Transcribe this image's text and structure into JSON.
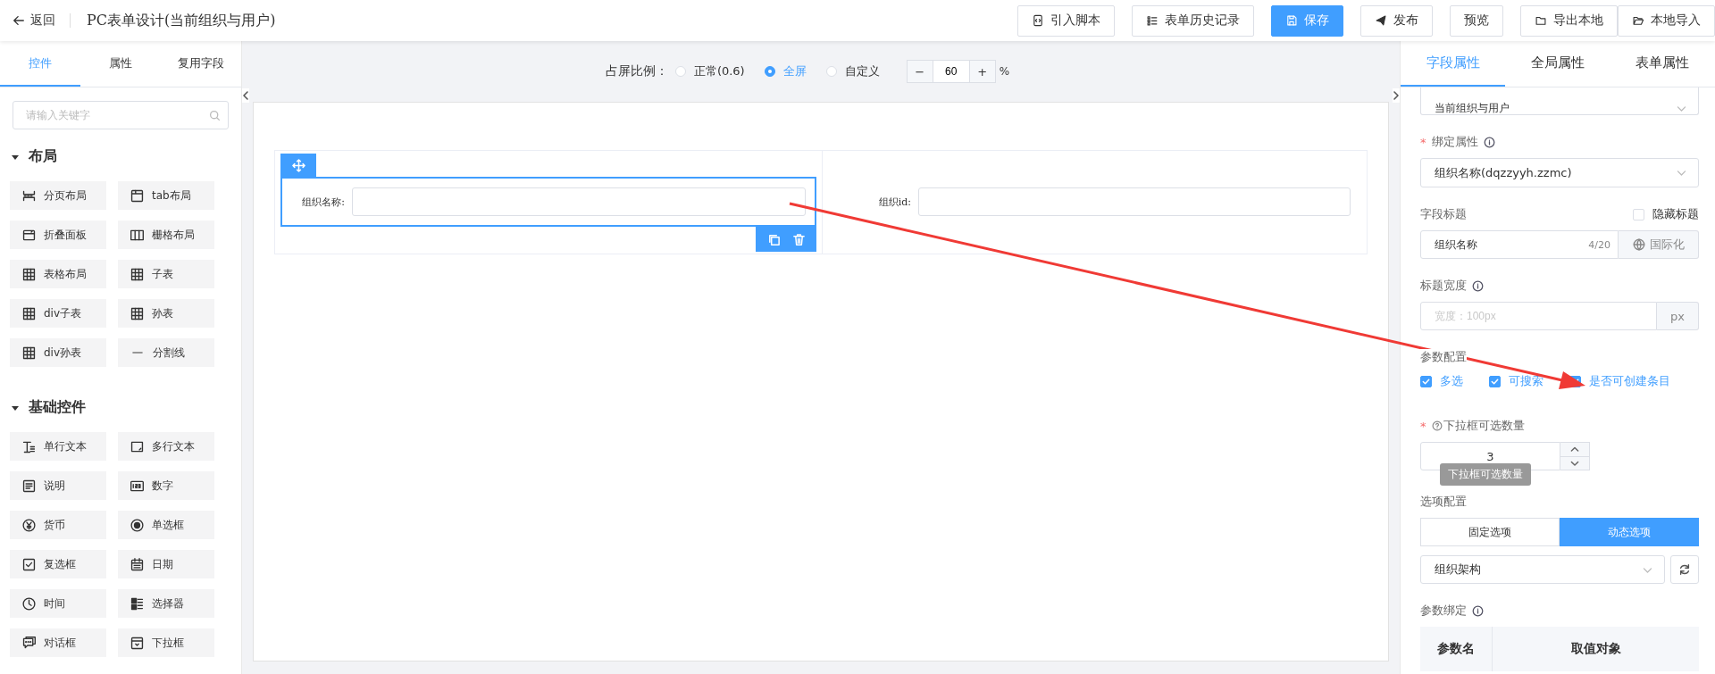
{
  "header": {
    "back": "返回",
    "title": "PC表单设计(当前组织与用户)",
    "buttons": [
      {
        "label": "引入脚本",
        "kind": "script",
        "primary": false
      },
      {
        "label": "表单历史记录",
        "kind": "list",
        "primary": false
      },
      {
        "label": "保存",
        "kind": "save",
        "primary": true
      },
      {
        "label": "发布",
        "kind": "send",
        "primary": false
      },
      {
        "label": "预览",
        "kind": "plain",
        "primary": false
      },
      {
        "label": "导出本地",
        "kind": "folder",
        "primary": false
      },
      {
        "label": "本地导入",
        "kind": "folder-open",
        "primary": false
      }
    ]
  },
  "left_panel": {
    "tabs": [
      {
        "label": "控件",
        "selected": true
      },
      {
        "label": "属性",
        "selected": false
      },
      {
        "label": "复用字段",
        "selected": false
      }
    ],
    "search": {
      "placeholder": "请输入关键字"
    },
    "groups": [
      {
        "title": "布局",
        "expanded": true,
        "items": [
          {
            "label": "分页布局",
            "kind": "pager"
          },
          {
            "label": "tab布局",
            "kind": "tab"
          },
          {
            "label": "折叠面板",
            "kind": "collapse"
          },
          {
            "label": "栅格布局",
            "kind": "columns"
          },
          {
            "label": "表格布局",
            "kind": "table"
          },
          {
            "label": "子表",
            "kind": "table"
          },
          {
            "label": "div子表",
            "kind": "table"
          },
          {
            "label": "孙表",
            "kind": "table"
          },
          {
            "label": "div孙表",
            "kind": "table"
          },
          {
            "label": "分割线",
            "kind": "line"
          }
        ]
      },
      {
        "title": "基础控件",
        "expanded": true,
        "items": [
          {
            "label": "单行文本",
            "kind": "text"
          },
          {
            "label": "多行文本",
            "kind": "textarea"
          },
          {
            "label": "说明",
            "kind": "note"
          },
          {
            "label": "数字",
            "kind": "number"
          },
          {
            "label": "货币",
            "kind": "currency"
          },
          {
            "label": "单选框",
            "kind": "radio"
          },
          {
            "label": "复选框",
            "kind": "checkbox"
          },
          {
            "label": "日期",
            "kind": "date"
          },
          {
            "label": "时间",
            "kind": "time"
          },
          {
            "label": "选择器",
            "kind": "selector"
          },
          {
            "label": "对话框",
            "kind": "dialog"
          },
          {
            "label": "下拉框",
            "kind": "dropdown"
          }
        ]
      }
    ]
  },
  "canvas": {
    "ratio_label": "占屏比例：",
    "ratio_options": [
      {
        "label": "正常(0.6)",
        "selected": false
      },
      {
        "label": "全屏",
        "selected": true
      },
      {
        "label": "自定义",
        "selected": false
      }
    ],
    "zoom": {
      "minus": "−",
      "value": "60",
      "plus": "+",
      "unit": "%"
    },
    "fields": [
      {
        "label": "组织名称:",
        "selected": true
      },
      {
        "label": "组织id:",
        "selected": false
      }
    ]
  },
  "right_panel": {
    "tabs": [
      {
        "label": "字段属性",
        "selected": true
      },
      {
        "label": "全局属性",
        "selected": false
      },
      {
        "label": "表单属性",
        "selected": false
      }
    ],
    "source_select": {
      "value": "当前组织与用户"
    },
    "bind": {
      "required_mark": "*",
      "label": "绑定属性",
      "value": "组织名称(dqzzyyh.zzmc)"
    },
    "title_field": {
      "label": "字段标题",
      "hide_label": "隐藏标题",
      "hide_checked": false,
      "value": "组织名称",
      "count": "4/20",
      "i18n": "国际化"
    },
    "width_field": {
      "label": "标题宽度",
      "placeholder": "宽度：100px",
      "unit": "px"
    },
    "params": {
      "label": "参数配置",
      "options": [
        {
          "label": "多选",
          "checked": true
        },
        {
          "label": "可搜索",
          "checked": true
        },
        {
          "label": "是否可创建条目",
          "checked": true
        }
      ]
    },
    "count_field": {
      "required_mark": "*",
      "label": "下拉框可选数量",
      "value": "3",
      "tooltip": "下拉框可选数量"
    },
    "options_config": {
      "label": "选项配置",
      "modes": [
        {
          "label": "固定选项",
          "selected": false
        },
        {
          "label": "动态选项",
          "selected": true
        }
      ],
      "source": "组织架构"
    },
    "param_binding": {
      "label": "参数绑定",
      "columns": [
        "参数名",
        "取值对象"
      ]
    }
  }
}
